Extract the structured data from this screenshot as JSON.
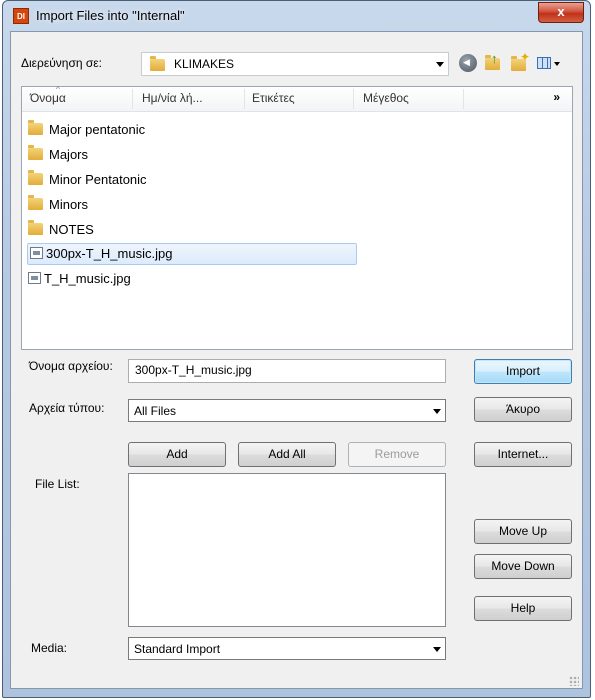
{
  "window": {
    "title": "Import Files into \"Internal\"",
    "app_icon": "DI",
    "close_label": "x"
  },
  "toolbar": {
    "look_in_label": "Διερεύνηση σε:",
    "look_in_value": "KLIMAKES",
    "icons": [
      "back-icon",
      "up-folder-icon",
      "new-folder-icon",
      "views-menu-icon"
    ]
  },
  "file_list": {
    "columns": [
      "Όνομα",
      "Ημ/νία λή...",
      "Ετικέτες",
      "Μέγεθος"
    ],
    "more_columns": "»",
    "items": [
      {
        "name": "Major pentatonic",
        "type": "folder"
      },
      {
        "name": "Majors",
        "type": "folder"
      },
      {
        "name": "Minor Pentatonic",
        "type": "folder"
      },
      {
        "name": "Minors",
        "type": "folder"
      },
      {
        "name": "NOTES",
        "type": "folder"
      },
      {
        "name": "300px-T_H_music.jpg",
        "type": "file",
        "selected": true
      },
      {
        "name": "T_H_music.jpg",
        "type": "file"
      }
    ]
  },
  "filename": {
    "label": "Όνομα αρχείου:",
    "value": "300px-T_H_music.jpg"
  },
  "filetype": {
    "label": "Αρχεία τύπου:",
    "value": "All Files"
  },
  "buttons": {
    "import": "Import",
    "cancel": "Άκυρο",
    "internet": "Internet...",
    "add": "Add",
    "add_all": "Add All",
    "remove": "Remove",
    "move_up": "Move Up",
    "move_down": "Move Down",
    "help": "Help"
  },
  "import_list": {
    "label": "File List:"
  },
  "media": {
    "label": "Media:",
    "value": "Standard Import"
  },
  "colors": {
    "selection": "#dcebfc",
    "default_button": "#bee6fd",
    "close_button": "#c0301a",
    "title_bar": "#b6c9e2"
  }
}
